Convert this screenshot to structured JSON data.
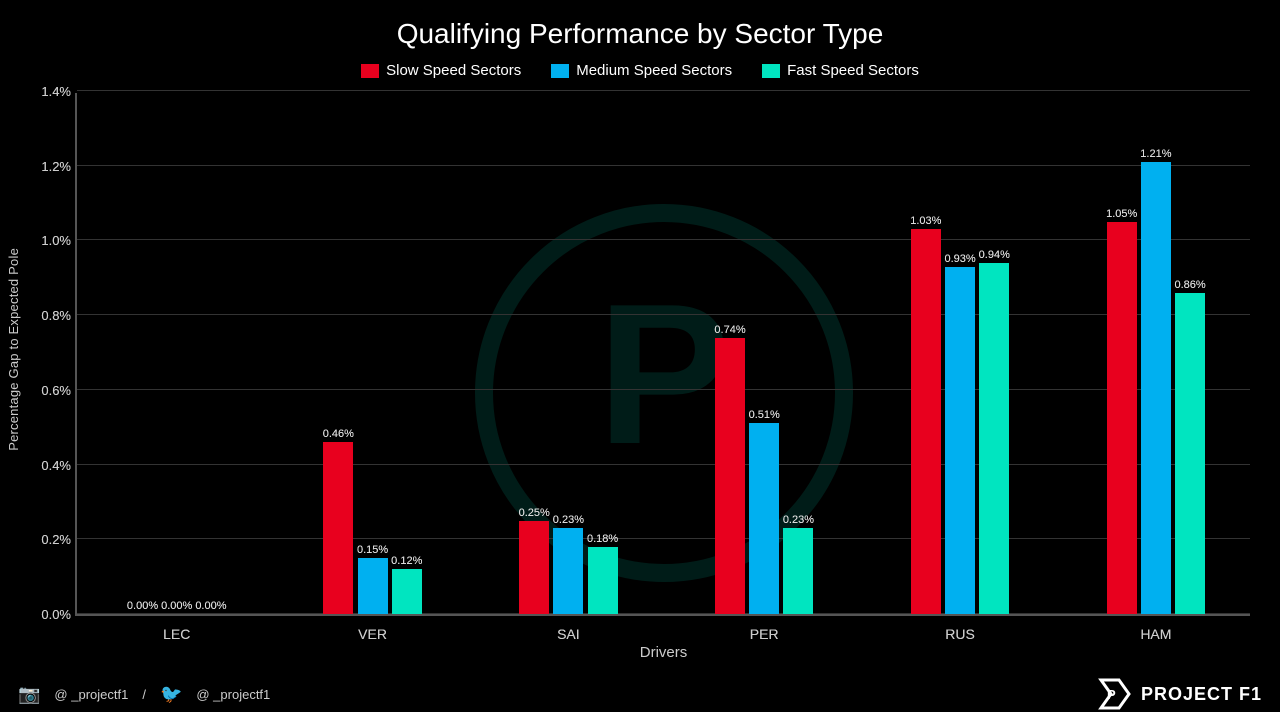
{
  "title": "Qualifying Performance by Sector Type",
  "legend": {
    "items": [
      {
        "label": "Slow Speed Sectors",
        "color": "#e8001e",
        "id": "slow"
      },
      {
        "label": "Medium Speed Sectors",
        "color": "#00b0f0",
        "id": "medium"
      },
      {
        "label": "Fast Speed Sectors",
        "color": "#00e5c0",
        "id": "fast"
      }
    ]
  },
  "yAxis": {
    "label": "Percentage Gap to Expected Pole",
    "ticks": [
      {
        "value": 0.0,
        "label": "0.0%"
      },
      {
        "value": 0.002,
        "label": "0.2%"
      },
      {
        "value": 0.004,
        "label": "0.4%"
      },
      {
        "value": 0.006,
        "label": "0.6%"
      },
      {
        "value": 0.008,
        "label": "0.8%"
      },
      {
        "value": 0.01,
        "label": "1.0%"
      },
      {
        "value": 0.012,
        "label": "1.2%"
      },
      {
        "value": 0.014,
        "label": "1.4%"
      }
    ],
    "max": 0.014
  },
  "xAxis": {
    "label": "Drivers"
  },
  "drivers": [
    {
      "name": "LEC",
      "slow": 0.0,
      "medium": 0.0,
      "fast": 0.0,
      "slowLabel": "0.00%",
      "mediumLabel": "0.00%",
      "fastLabel": "0.00%"
    },
    {
      "name": "VER",
      "slow": 0.46,
      "medium": 0.15,
      "fast": 0.12,
      "slowLabel": "0.46%",
      "mediumLabel": "0.15%",
      "fastLabel": "0.12%"
    },
    {
      "name": "SAI",
      "slow": 0.25,
      "medium": 0.23,
      "fast": 0.18,
      "slowLabel": "0.25%",
      "mediumLabel": "0.23%",
      "fastLabel": "0.18%"
    },
    {
      "name": "PER",
      "slow": 0.74,
      "medium": 0.51,
      "fast": 0.23,
      "slowLabel": "0.74%",
      "mediumLabel": "0.51%",
      "fastLabel": "0.23%"
    },
    {
      "name": "RUS",
      "slow": 1.03,
      "medium": 0.93,
      "fast": 0.94,
      "slowLabel": "1.03%",
      "mediumLabel": "0.93%",
      "fastLabel": "0.94%"
    },
    {
      "name": "HAM",
      "slow": 1.05,
      "medium": 1.21,
      "fast": 0.86,
      "slowLabel": "1.05%",
      "mediumLabel": "1.21%",
      "fastLabel": "0.86%"
    }
  ],
  "footer": {
    "social1": "@ _projectf1",
    "social2": "@ _projectf1",
    "brand": "PROJECT F1"
  },
  "colors": {
    "slow": "#e8001e",
    "medium": "#00b0f0",
    "fast": "#00e5c0",
    "background": "#000000",
    "gridLine": "#333333",
    "axis": "#555555"
  }
}
